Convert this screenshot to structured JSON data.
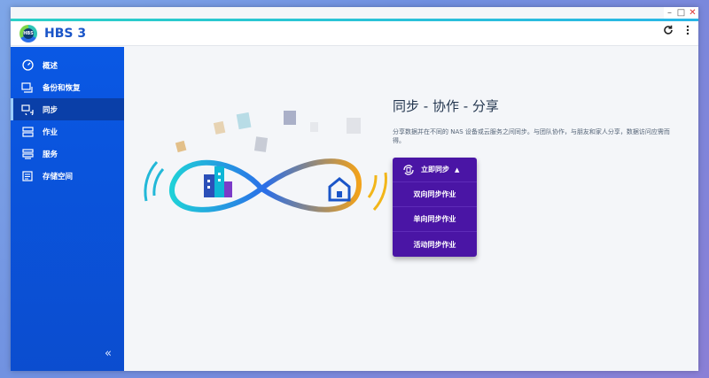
{
  "app": {
    "title": "HBS 3",
    "logo_text": "HBS"
  },
  "window_controls": {
    "minimize": "–",
    "maximize": "□",
    "close": "✕"
  },
  "header": {
    "refresh_icon": "refresh-icon",
    "more_icon": "more-vertical-icon"
  },
  "sidebar": {
    "items": [
      {
        "label": "概述",
        "icon": "gauge-icon",
        "active": false
      },
      {
        "label": "备份和恢复",
        "icon": "backup-restore-icon",
        "active": false
      },
      {
        "label": "同步",
        "icon": "sync-icon",
        "active": true
      },
      {
        "label": "作业",
        "icon": "jobs-icon",
        "active": false
      },
      {
        "label": "服务",
        "icon": "services-icon",
        "active": false
      },
      {
        "label": "存储空间",
        "icon": "storage-icon",
        "active": false
      }
    ],
    "collapse_label": "«"
  },
  "main": {
    "headline": "同步 - 协作 - 分享",
    "description": "分享数据并在不同的 NAS 设备或云服务之间同步。与团队协作，与朋友和家人分享，数据访问应需而得。"
  },
  "sync_menu": {
    "header_label": "立即同步",
    "caret": "▲",
    "items": [
      "双向同步作业",
      "单向同步作业",
      "活动同步作业"
    ]
  },
  "colors": {
    "sidebar": "#0a58e4",
    "accent": "#29b6e6",
    "menu": "#4a15a5",
    "brand_text": "#1a55c8"
  }
}
